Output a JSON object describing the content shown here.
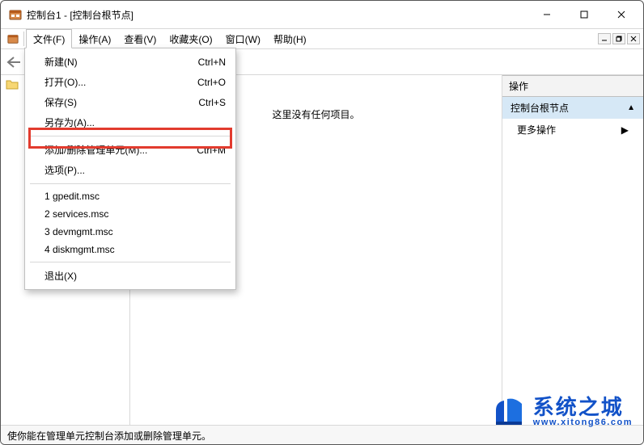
{
  "window": {
    "title": "控制台1 - [控制台根节点]"
  },
  "menubar": {
    "file": "文件(F)",
    "action": "操作(A)",
    "view": "查看(V)",
    "favorites": "收藏夹(O)",
    "window": "窗口(W)",
    "help": "帮助(H)"
  },
  "file_menu": {
    "new": {
      "label": "新建(N)",
      "shortcut": "Ctrl+N"
    },
    "open": {
      "label": "打开(O)...",
      "shortcut": "Ctrl+O"
    },
    "save": {
      "label": "保存(S)",
      "shortcut": "Ctrl+S"
    },
    "saveas": {
      "label": "另存为(A)...",
      "shortcut": ""
    },
    "addremove": {
      "label": "添加/删除管理单元(M)...",
      "shortcut": "Ctrl+M"
    },
    "options": {
      "label": "选项(P)...",
      "shortcut": ""
    },
    "recent1": {
      "label": "1 gpedit.msc",
      "shortcut": ""
    },
    "recent2": {
      "label": "2 services.msc",
      "shortcut": ""
    },
    "recent3": {
      "label": "3 devmgmt.msc",
      "shortcut": ""
    },
    "recent4": {
      "label": "4 diskmgmt.msc",
      "shortcut": ""
    },
    "exit": {
      "label": "退出(X)",
      "shortcut": ""
    }
  },
  "center": {
    "empty": "这里没有任何项目。"
  },
  "actions_panel": {
    "header": "操作",
    "root": "控制台根节点",
    "more": "更多操作"
  },
  "statusbar": {
    "text": "使你能在管理单元控制台添加或删除管理单元。"
  },
  "watermark": {
    "cn": "系统之城",
    "en": "www.xitong86.com"
  }
}
